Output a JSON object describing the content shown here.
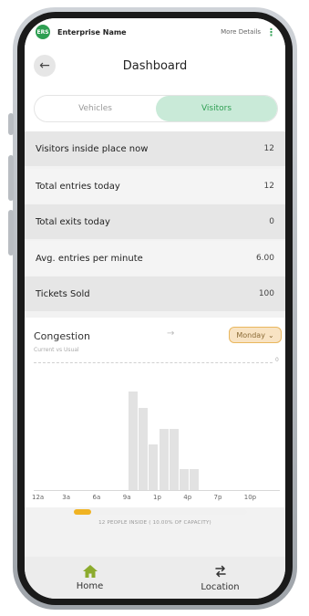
{
  "status_bar": {
    "enterprise_name": "Enterprise Name",
    "more_details": "More Details",
    "logo_text": "ERS"
  },
  "header": {
    "title": "Dashboard"
  },
  "segmented": {
    "tabs": [
      {
        "label": "Vehicles",
        "active": false
      },
      {
        "label": "Visitors",
        "active": true
      }
    ]
  },
  "stats": [
    {
      "label": "Visitors  inside place now",
      "value": "12"
    },
    {
      "label": "Total entries today",
      "value": "12"
    },
    {
      "label": "Total exits today",
      "value": "0"
    },
    {
      "label": "Avg. entries per minute",
      "value": "6.00"
    },
    {
      "label": "Tickets  Sold",
      "value": "100"
    }
  ],
  "congestion": {
    "title": "Congestion",
    "subtitle": "Current vs Usual",
    "arrow": "→",
    "day": "Monday",
    "zero_label": "0",
    "capacity_text": "12 PEOPLE INSIDE ( 10.00% OF CAPACITY)",
    "capacity_fraction": 0.1
  },
  "chart_data": {
    "type": "bar",
    "ticks": [
      "12a",
      "3a",
      "6a",
      "9a",
      "1p",
      "4p",
      "7p",
      "10p"
    ],
    "values": [
      0,
      0,
      0,
      0,
      0,
      0,
      0,
      0,
      0,
      0,
      0,
      0,
      0,
      0,
      0,
      0,
      0,
      0,
      0,
      0,
      0,
      0,
      0,
      0,
      0,
      0,
      0,
      0,
      0,
      0,
      0,
      0,
      0,
      0,
      0,
      0,
      0,
      0,
      0,
      0,
      0,
      0,
      0,
      0,
      0,
      0,
      0,
      0,
      0,
      0
    ],
    "bars": [
      {
        "hour": 9,
        "value": 0.74
      },
      {
        "hour": 10,
        "value": 0.62
      },
      {
        "hour": 11,
        "value": 0.34
      },
      {
        "hour": 12,
        "value": 0.46
      },
      {
        "hour": 13,
        "value": 0.46
      },
      {
        "hour": 14,
        "value": 0.16
      },
      {
        "hour": 15,
        "value": 0.16
      }
    ]
  },
  "navbar": {
    "items": [
      {
        "label": "Home",
        "icon": "home-icon",
        "color": "#8cab2e"
      },
      {
        "label": "Location",
        "icon": "swap-icon",
        "color": "#333333"
      }
    ]
  }
}
